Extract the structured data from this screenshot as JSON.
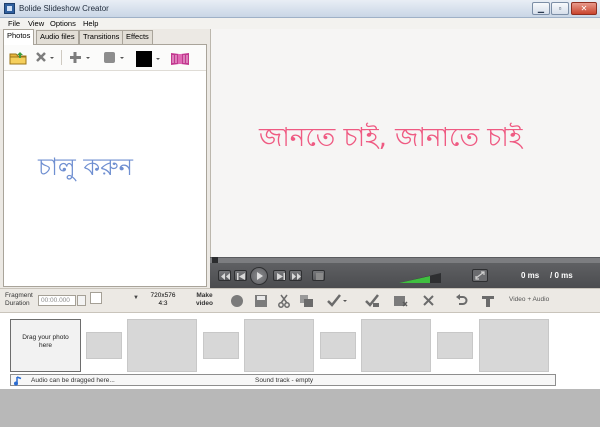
{
  "window": {
    "title": "Bolide Slideshow Creator",
    "minimize": "▁",
    "maximize": "▫",
    "close": "✕"
  },
  "menu": [
    "File",
    "View",
    "Options",
    "Help"
  ],
  "tabs": [
    "Photos",
    "Audio files",
    "Transitions",
    "Effects"
  ],
  "left_overlay_text": "চালু করুন",
  "preview_text": "জানতে চাই, জানাতে চাই",
  "player": {
    "time_current": "0 ms",
    "time_total": "/ 0 ms"
  },
  "fragment": {
    "label_line1": "Fragment",
    "label_line2": "Duration",
    "duration_placeholder": "00:00.000",
    "resolution_line1": "720x576",
    "resolution_line2": "4:3",
    "make_video_line1": "Make",
    "make_video_line2": "video",
    "video_audio": "Video + Audio"
  },
  "timeline": {
    "drop_line1": "Drag your photo",
    "drop_line2": "here",
    "audio_hint": "Audio can be dragged here...",
    "soundtrack_status": "Sound track - empty"
  },
  "colors": {
    "left_overlay": "#6f8fd1",
    "preview_text": "#ef5a82",
    "player_bg": "#55565a",
    "volume_green": "#3fbf3f"
  },
  "icons": [
    "open-folder-icon",
    "delete-icon",
    "add-icon",
    "shape-icon",
    "color-icon",
    "film-icon",
    "rewind-icon",
    "prev-icon",
    "play-icon",
    "next-icon",
    "end-icon",
    "stop-icon",
    "volume-icon",
    "fullscreen-icon",
    "record-icon",
    "save-icon",
    "cut-icon",
    "copy-icon",
    "check-icon",
    "check-all-icon",
    "image-delete-icon",
    "remove-icon",
    "undo-icon",
    "text-icon",
    "music-note-icon"
  ]
}
